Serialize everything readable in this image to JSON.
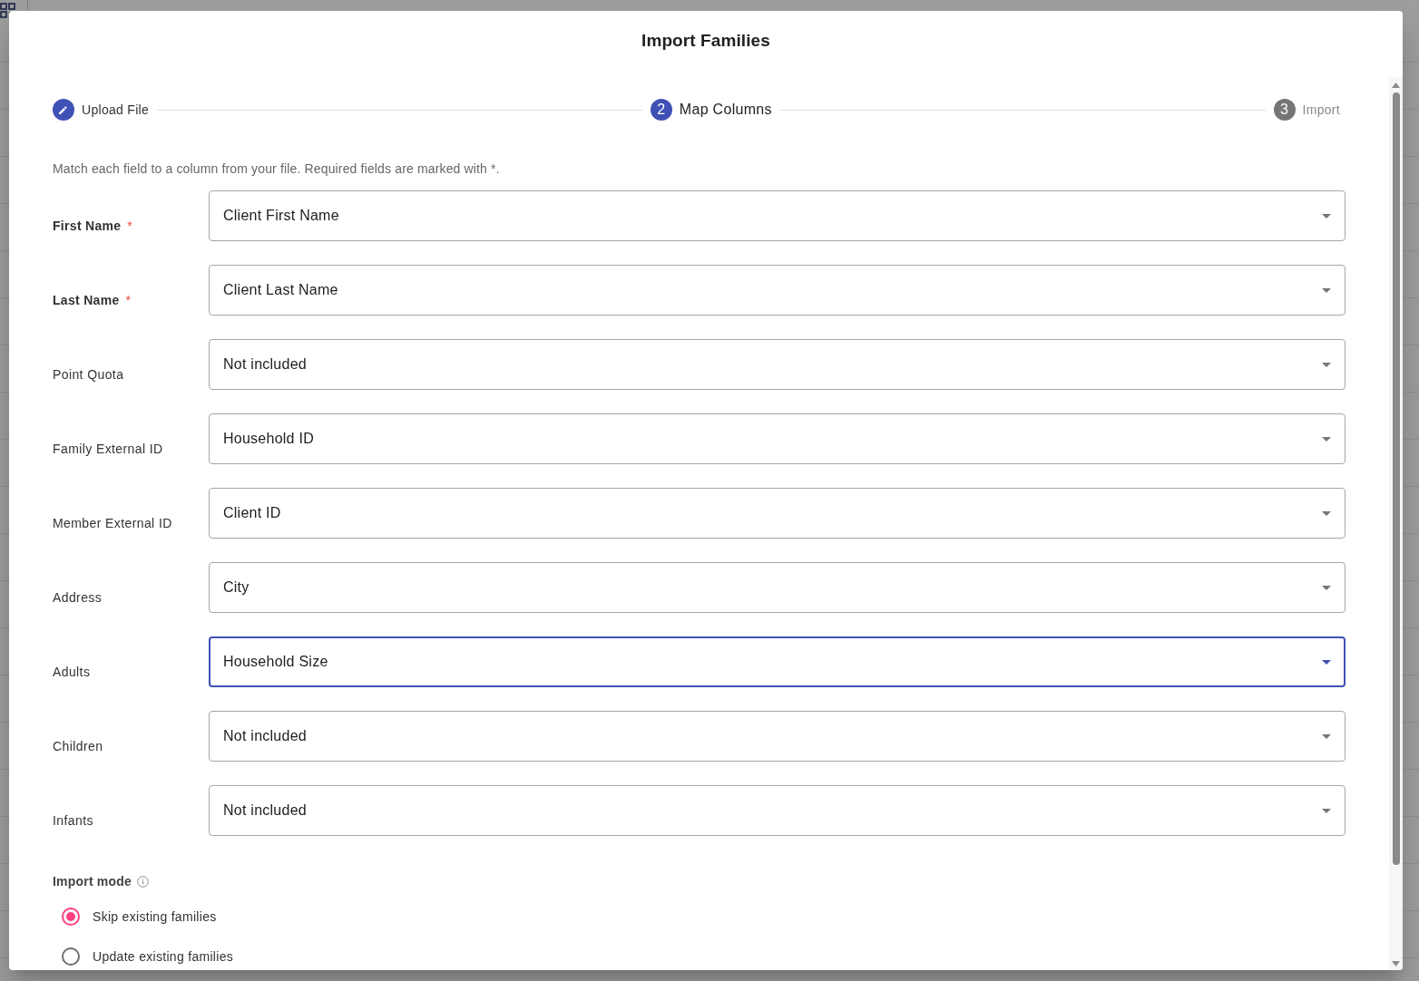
{
  "dialog": {
    "title": "Import Families"
  },
  "steps": [
    {
      "kind": "edit",
      "label": "Upload File",
      "selected": false
    },
    {
      "kind": "number",
      "number": "2",
      "label": "Map Columns",
      "selected": true
    },
    {
      "kind": "number",
      "number": "3",
      "label": "Import",
      "selected": false
    }
  ],
  "description": "Match each field to a column from your file. Required fields are marked with *.",
  "fields": [
    {
      "label": "First Name",
      "required": true,
      "required_mark": "*",
      "value": "Client First Name",
      "focused": false
    },
    {
      "label": "Last Name",
      "required": true,
      "required_mark": "*",
      "value": "Client Last Name",
      "focused": false
    },
    {
      "label": "Point Quota",
      "required": false,
      "value": "Not included",
      "focused": false
    },
    {
      "label": "Family External ID",
      "required": false,
      "value": "Household ID",
      "focused": false
    },
    {
      "label": "Member External ID",
      "required": false,
      "value": "Client ID",
      "focused": false
    },
    {
      "label": "Address",
      "required": false,
      "value": "City",
      "focused": false
    },
    {
      "label": "Adults",
      "required": false,
      "value": "Household Size",
      "focused": true
    },
    {
      "label": "Children",
      "required": false,
      "value": "Not included",
      "focused": false
    },
    {
      "label": "Infants",
      "required": false,
      "value": "Not included",
      "focused": false
    }
  ],
  "import_mode": {
    "label": "Import mode",
    "options": [
      {
        "label": "Skip existing families",
        "selected": true
      },
      {
        "label": "Update existing families",
        "selected": false
      }
    ]
  }
}
